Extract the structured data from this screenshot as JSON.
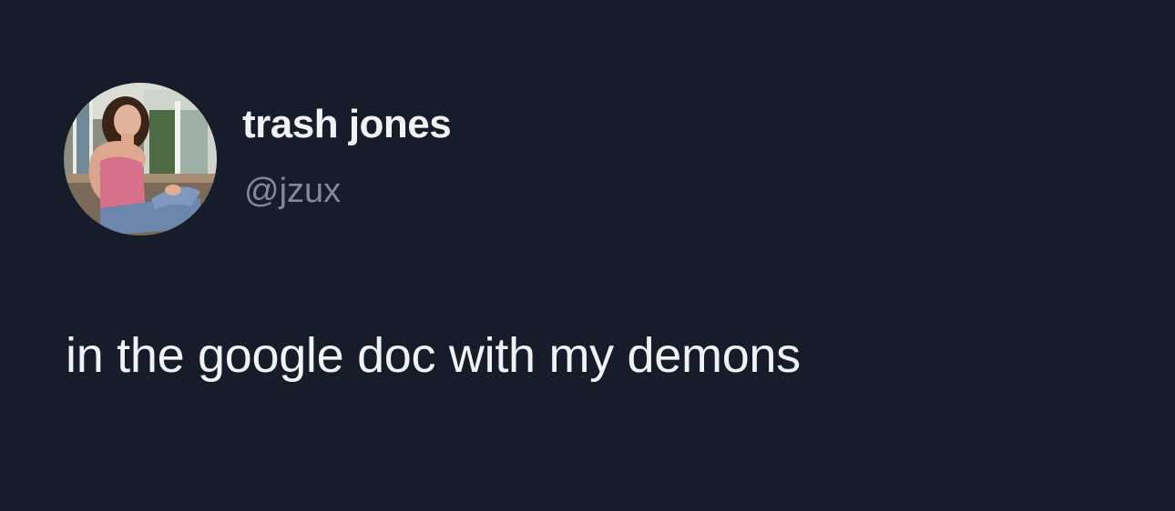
{
  "tweet": {
    "author": {
      "display_name": "trash jones",
      "handle": "@jzux"
    },
    "text": "in the google doc with my demons"
  },
  "colors": {
    "background": "#161c29",
    "display_name": "#f2f3f5",
    "handle": "#7f8a98",
    "text": "#f1f2f4"
  }
}
